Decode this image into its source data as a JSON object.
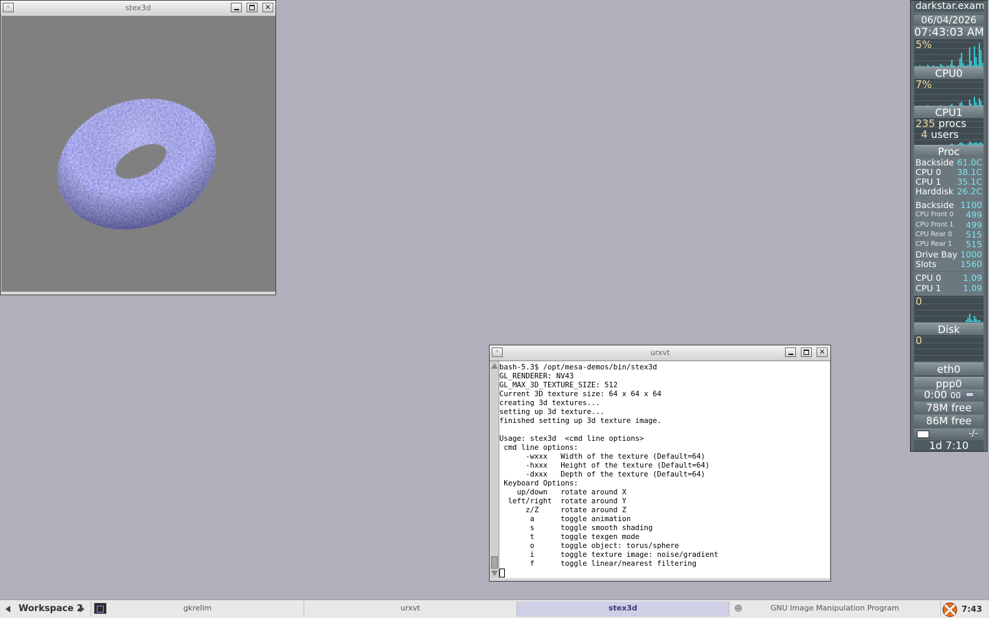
{
  "desktop": {
    "background": "#b0b0bc"
  },
  "stex3d_window": {
    "title": "stex3d",
    "canvas_bg": "#808080"
  },
  "terminal_window": {
    "title": "urxvt",
    "lines": [
      "bash-5.3$ /opt/mesa-demos/bin/stex3d",
      "GL_RENDERER: NV43",
      "GL_MAX_3D_TEXTURE_SIZE: 512",
      "Current 3D texture size: 64 x 64 x 64",
      "creating 3d textures...",
      "setting up 3d texture...",
      "finished setting up 3d texture image.",
      "",
      "Usage: stex3d  <cmd line options>",
      " cmd line options:",
      "      -wxxx   Width of the texture (Default=64)",
      "      -hxxx   Height of the texture (Default=64)",
      "      -dxxx   Depth of the texture (Default=64)",
      " Keyboard Options:",
      "    up/down   rotate around X",
      "  left/right  rotate around Y",
      "      z/Z     rotate around Z",
      "       a      toggle animation",
      "       s      toggle smooth shading",
      "       t      toggle texgen mode",
      "       o      toggle object: torus/sphere",
      "       i      toggle texture image: noise/gradient",
      "       f      toggle linear/nearest filtering"
    ]
  },
  "gkrellm": {
    "hostname": "darkstar.exampl",
    "date": "06/04/2026",
    "time": "07:43:03 AM",
    "cpu0_pct": "5%",
    "cpu0_label": "CPU0",
    "cpu1_pct": "7%",
    "cpu1_label": "CPU1",
    "procs_count": "235",
    "procs_word": "procs",
    "users_count": "4",
    "users_word": "users",
    "proc_label": "Proc",
    "temps": [
      {
        "name": "Backside",
        "value": "61.0C"
      },
      {
        "name": "CPU 0",
        "value": "38.1C"
      },
      {
        "name": "CPU 1",
        "value": "35.1C"
      },
      {
        "name": "Harddisk",
        "value": "26.2C"
      }
    ],
    "fans": [
      {
        "name": "Backside",
        "value": "1100",
        "small": false
      },
      {
        "name": "CPU Front 0",
        "value": "499",
        "small": true
      },
      {
        "name": "CPU Front 1",
        "value": "499",
        "small": true
      },
      {
        "name": "CPU Rear 0",
        "value": "515",
        "small": true
      },
      {
        "name": "CPU Rear 1",
        "value": "515",
        "small": true
      },
      {
        "name": "Drive Bay",
        "value": "1000",
        "small": false
      },
      {
        "name": "Slots",
        "value": "1560",
        "small": false
      }
    ],
    "volts": [
      {
        "name": "CPU 0",
        "value": "1.09"
      },
      {
        "name": "CPU 1",
        "value": "1.09"
      }
    ],
    "disk_value": "0",
    "disk_label": "Disk",
    "net_value": "0",
    "eth0_label": "eth0",
    "ppp0_label": "ppp0",
    "ppp_time": "0:00",
    "ppp_time2": "00",
    "mem_free": "78M free",
    "swap_free": "86M free",
    "mail_status": "-/-",
    "uptime": "1d  7:10",
    "cpu0_spark": [
      0,
      1,
      0,
      2,
      1,
      0,
      1,
      0,
      3,
      1,
      0,
      1,
      2,
      0,
      1,
      0,
      4,
      2,
      1,
      0,
      2,
      1,
      3,
      10,
      2,
      1,
      0,
      2,
      12,
      20,
      5,
      2,
      1,
      3,
      28,
      8,
      2,
      30,
      14,
      3,
      34,
      24,
      6
    ],
    "cpu1_spark": [
      0,
      1,
      0,
      1,
      0,
      0,
      1,
      0,
      2,
      1,
      0,
      1,
      0,
      0,
      1,
      0,
      2,
      1,
      0,
      0,
      1,
      1,
      2,
      4,
      1,
      1,
      0,
      1,
      5,
      7,
      2,
      1,
      0,
      1,
      10,
      4,
      1,
      14,
      6,
      2,
      12,
      8,
      2
    ],
    "proc_spark": [
      0,
      0,
      0,
      1,
      0,
      0,
      0,
      0,
      1,
      0,
      0,
      0,
      1,
      0,
      0,
      0,
      1,
      1,
      0,
      0,
      1,
      0,
      2,
      3,
      2,
      1,
      1,
      2,
      4,
      5,
      3,
      2,
      1,
      3,
      6,
      5,
      3,
      4,
      5,
      3,
      4,
      5,
      3
    ],
    "disk_spark": [
      0,
      0,
      0,
      0,
      0,
      0,
      0,
      0,
      0,
      0,
      0,
      0,
      0,
      0,
      0,
      0,
      0,
      0,
      0,
      0,
      0,
      0,
      0,
      0,
      0,
      0,
      0,
      0,
      0,
      0,
      0,
      0,
      3,
      6,
      12,
      4,
      2,
      9,
      5,
      2,
      3,
      1,
      0
    ]
  },
  "taskbar": {
    "workspace": "Workspace 2",
    "tasks": [
      {
        "label": "gkrellm",
        "active": false
      },
      {
        "label": "urxvt",
        "active": false
      },
      {
        "label": "stex3d",
        "active": true
      },
      {
        "label": "GNU Image Manipulation Program",
        "active": false
      }
    ],
    "clock": "7:43"
  }
}
